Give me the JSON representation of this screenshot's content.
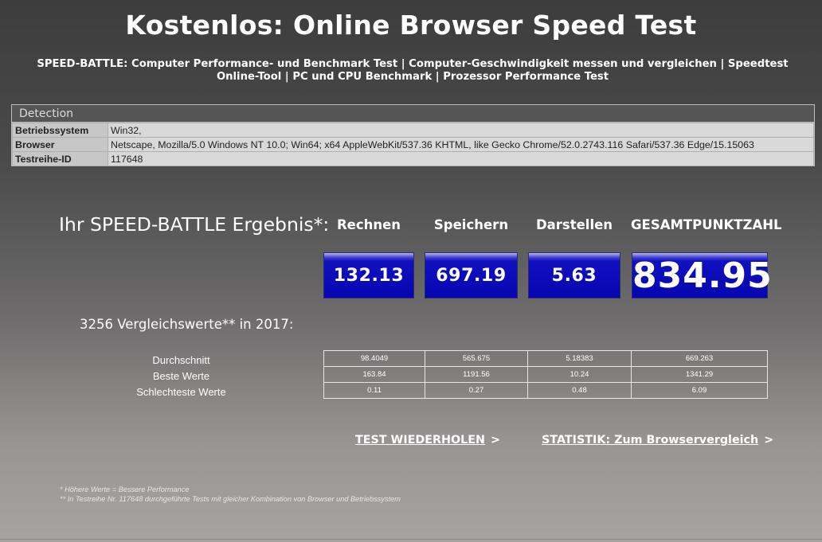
{
  "title": "Kostenlos: Online Browser Speed Test",
  "subtitle": "SPEED-BATTLE: Computer Performance- und Benchmark Test | Computer-Geschwindigkeit messen und vergleichen | Speedtest Online-Tool | PC und CPU Benchmark | Prozessor Performance Test",
  "detection": {
    "heading": "Detection",
    "rows": [
      {
        "key": "Betriebssystem",
        "value": "Win32,"
      },
      {
        "key": "Browser",
        "value": "Netscape, Mozilla/5.0 Windows NT 10.0; Win64; x64 AppleWebKit/537.36 KHTML, like Gecko Chrome/52.0.2743.116 Safari/537.36 Edge/15.15063"
      },
      {
        "key": "Testreihe-ID",
        "value": "117648"
      }
    ]
  },
  "result": {
    "title": "Ihr SPEED-BATTLE Ergebnis*:",
    "columns": [
      "Rechnen",
      "Speichern",
      "Darstellen",
      "GESAMTPUNKTZAHL"
    ],
    "scores": [
      "132.13",
      "697.19",
      "5.63",
      "834.95"
    ],
    "colors": {
      "score_blue": "#0606b0"
    }
  },
  "comparison": {
    "title": "3256 Vergleichswerte** in 2017:",
    "rows": [
      {
        "label": "Durchschnitt",
        "values": [
          "98.4049",
          "565.675",
          "5.18383",
          "669.263"
        ]
      },
      {
        "label": "Beste Werte",
        "values": [
          "163.84",
          "1191.56",
          "10.24",
          "1341.29"
        ]
      },
      {
        "label": "Schlechteste Werte",
        "values": [
          "0.11",
          "0.27",
          "0.48",
          "6.09"
        ]
      }
    ]
  },
  "links": {
    "repeat": "TEST WIEDERHOLEN",
    "stats": "STATISTIK: Zum Browservergleich",
    "arrow": ">"
  },
  "footnotes": [
    "* Höhere Werte = Bessere Performance",
    "** In Testreihe Nr. 117648 durchgeführte Tests mit gleicher Kombination von Browser und Betriebssystem"
  ]
}
